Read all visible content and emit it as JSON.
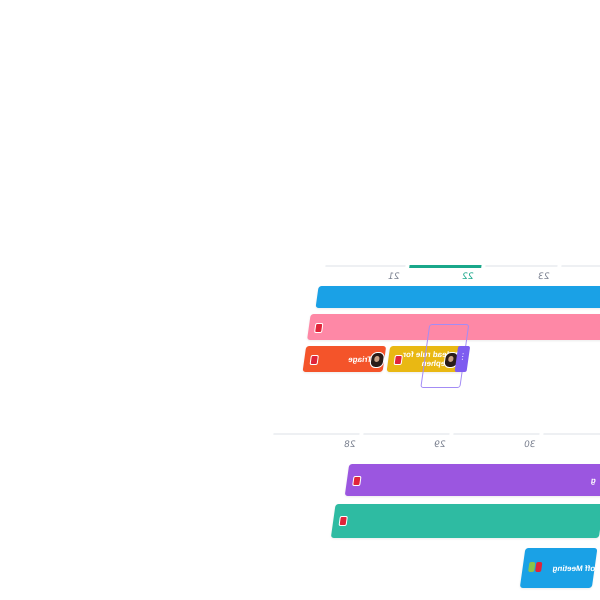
{
  "week1": {
    "days": [
      {
        "label": "21"
      },
      {
        "label": "22"
      },
      {
        "label": "23"
      }
    ],
    "today_label": "22",
    "bars": {
      "blue": {
        "color": "#1aa1e6"
      },
      "pink": {
        "color": "#fe88a6"
      },
      "orange": {
        "color": "#f4542a",
        "text": "Daily Triage"
      },
      "yellow": {
        "color": "#e9b813",
        "text_line1": "Create lead rule for",
        "text_line2": "Stephen"
      },
      "drag_chip_text": "⋮"
    }
  },
  "week2": {
    "days": [
      {
        "label": "28"
      },
      {
        "label": "29"
      },
      {
        "label": "30"
      }
    ],
    "bars": {
      "purple": {
        "color": "#9b56e0",
        "text": "g"
      },
      "teal": {
        "color": "#2ebba2"
      },
      "blue_task": {
        "color": "#1aa1e6",
        "text": "Kick-off Meeting"
      }
    }
  },
  "icons": {
    "check": "✓",
    "priority_flag": "flag-icon",
    "avatar": "avatar-icon"
  },
  "colors": {
    "today_accent": "#19a78a",
    "priority_red": "#e0243a",
    "drag_outline": "#a38cf5",
    "drag_chip": "#7e5cf0"
  }
}
